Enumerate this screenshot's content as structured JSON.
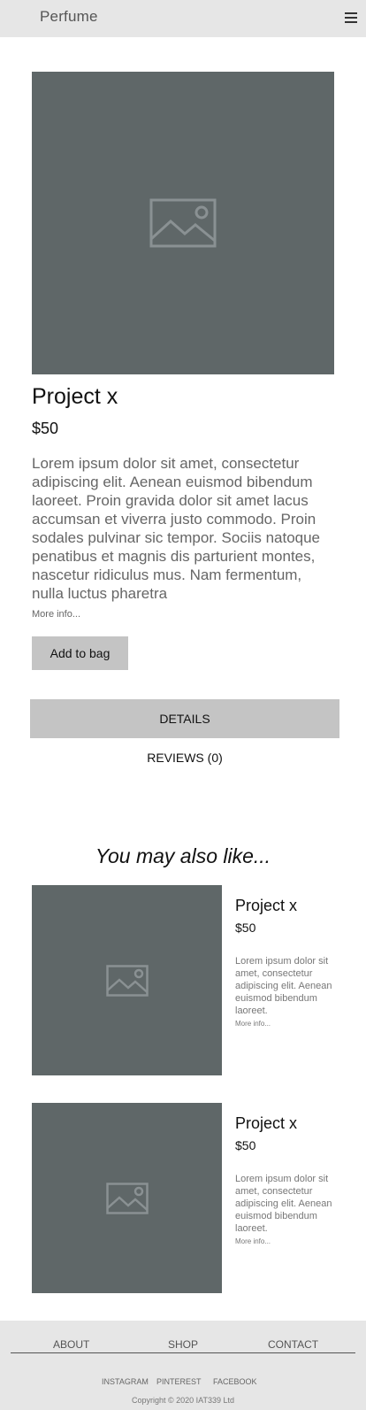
{
  "header": {
    "brand": "Perfume",
    "menu_icon": "hamburger-menu-icon"
  },
  "product": {
    "image_icon": "image-placeholder-icon",
    "title": "Project x",
    "price": "$50",
    "description": "Lorem ipsum dolor sit amet, consectetur adipiscing elit. Aenean euismod bibendum laoreet. Proin gravida dolor sit amet lacus accumsan et viverra justo commodo. Proin sodales pulvinar sic tempor. Sociis natoque penatibus et magnis dis parturient montes, nascetur ridiculus mus. Nam fermentum, nulla luctus pharetra",
    "more_info": "More info...",
    "add_to_bag": "Add to bag"
  },
  "tabs": [
    {
      "label": "DETAILS",
      "active": true
    },
    {
      "label": "REVIEWS (0)",
      "active": false
    }
  ],
  "related": {
    "heading": "You may also like...",
    "items": [
      {
        "title": "Project x",
        "price": "$50",
        "description": "Lorem ipsum dolor sit amet, consectetur adipiscing elit. Aenean euismod bibendum laoreet.",
        "more_info": "More info..."
      },
      {
        "title": "Project x",
        "price": "$50",
        "description": "Lorem ipsum dolor sit amet, consectetur adipiscing elit. Aenean euismod bibendum laoreet.",
        "more_info": "More info..."
      }
    ]
  },
  "footer": {
    "nav": [
      "ABOUT",
      "SHOP",
      "CONTACT"
    ],
    "social": [
      "INSTAGRAM",
      "PINTEREST",
      "FACEBOOK"
    ],
    "copyright": "Copyright © 2020 IAT339 Ltd"
  },
  "colors": {
    "header_bg": "#e6e6e6",
    "placeholder_bg": "#5f6768",
    "button_bg": "#c4c4c4",
    "footer_bg": "#e6e6e6"
  }
}
